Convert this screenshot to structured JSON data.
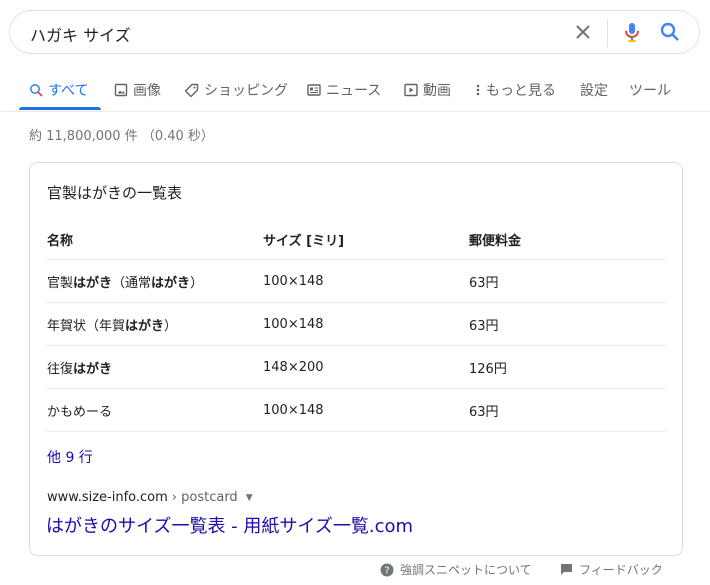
{
  "search": {
    "query": "ハガキ サイズ"
  },
  "tabs": [
    {
      "label": "すべて",
      "icon": "search-icon",
      "active": true
    },
    {
      "label": "画像",
      "icon": "image-icon"
    },
    {
      "label": "ショッピング",
      "icon": "tag-icon"
    },
    {
      "label": "ニュース",
      "icon": "news-icon"
    },
    {
      "label": "動画",
      "icon": "video-icon"
    },
    {
      "label": "もっと見る",
      "icon": "more-vert-icon"
    },
    {
      "label": "設定"
    },
    {
      "label": "ツール"
    }
  ],
  "result_stats": "約 11,800,000 件 （0.40 秒）",
  "snippet": {
    "title": "官製はがきの一覧表",
    "columns": [
      "名称",
      "サイズ [ミリ]",
      "郵便料金"
    ],
    "rows": [
      [
        "官製はがき（通常はがき）",
        "100×148",
        "63円"
      ],
      [
        "年賀状（年賀はがき）",
        "100×148",
        "63円"
      ],
      [
        "往復はがき",
        "148×200",
        "126円"
      ],
      [
        "かもめーる",
        "100×148",
        "63円"
      ]
    ],
    "more_rows": "他 9 行",
    "cite_domain": "www.size-info.com",
    "cite_path": " › postcard",
    "link_title": "はがきのサイズ一覧表 - 用紙サイズ一覧.com"
  },
  "footer": {
    "about": "強調スニペットについて",
    "feedback": "フィードバック"
  },
  "colors": {
    "accent": "#1a73e8",
    "link": "#1a0dab",
    "mic_red": "#ea4335",
    "muted": "#70757a"
  }
}
